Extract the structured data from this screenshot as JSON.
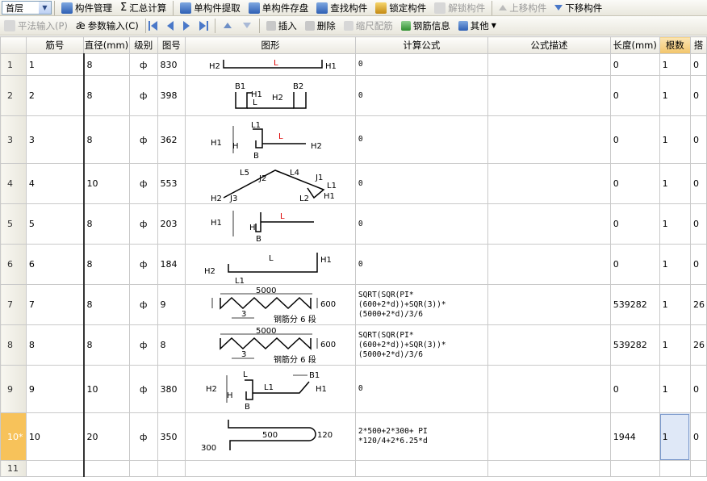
{
  "toolbar1": {
    "floor_value": "首层",
    "items": [
      "构件管理",
      "汇总计算",
      "单构件提取",
      "单构件存盘",
      "查找构件",
      "锁定构件",
      "解锁构件",
      "上移构件",
      "下移构件"
    ]
  },
  "toolbar2": {
    "items": [
      "平法输入(P)",
      "参数输入(C)",
      "插入",
      "删除",
      "缩尺配筋",
      "钢筋信息",
      "其他"
    ]
  },
  "columns": [
    "筋号",
    "直径(mm)",
    "级别",
    "图号",
    "图形",
    "计算公式",
    "公式描述",
    "长度(mm)",
    "根数",
    "搭"
  ],
  "rows": [
    {
      "idx": "1",
      "no": "1",
      "dia": "8",
      "grade": "ф",
      "fig": "830",
      "formula": "0",
      "desc": "",
      "len": "0",
      "count": "1",
      "lap": "0"
    },
    {
      "idx": "2",
      "no": "2",
      "dia": "8",
      "grade": "ф",
      "fig": "398",
      "formula": "0",
      "desc": "",
      "len": "0",
      "count": "1",
      "lap": "0"
    },
    {
      "idx": "3",
      "no": "3",
      "dia": "8",
      "grade": "ф",
      "fig": "362",
      "formula": "0",
      "desc": "",
      "len": "0",
      "count": "1",
      "lap": "0"
    },
    {
      "idx": "4",
      "no": "4",
      "dia": "10",
      "grade": "ф",
      "fig": "553",
      "formula": "0",
      "desc": "",
      "len": "0",
      "count": "1",
      "lap": "0"
    },
    {
      "idx": "5",
      "no": "5",
      "dia": "8",
      "grade": "ф",
      "fig": "203",
      "formula": "0",
      "desc": "",
      "len": "0",
      "count": "1",
      "lap": "0"
    },
    {
      "idx": "6",
      "no": "6",
      "dia": "8",
      "grade": "ф",
      "fig": "184",
      "formula": "0",
      "desc": "",
      "len": "0",
      "count": "1",
      "lap": "0"
    },
    {
      "idx": "7",
      "no": "7",
      "dia": "8",
      "grade": "ф",
      "fig": "9",
      "formula": "SQRT(SQR(PI*(600+2*d))+SQR(3))*(5000+2*d)/3/6",
      "desc": "",
      "len": "539282",
      "count": "1",
      "lap": "26"
    },
    {
      "idx": "8",
      "no": "8",
      "dia": "8",
      "grade": "ф",
      "fig": "8",
      "formula": "SQRT(SQR(PI*(600+2*d))+SQR(3))*(5000+2*d)/3/6",
      "desc": "",
      "len": "539282",
      "count": "1",
      "lap": "26"
    },
    {
      "idx": "9",
      "no": "9",
      "dia": "10",
      "grade": "ф",
      "fig": "380",
      "formula": "0",
      "desc": "",
      "len": "0",
      "count": "1",
      "lap": "0"
    },
    {
      "idx": "10*",
      "no": "10",
      "dia": "20",
      "grade": "ф",
      "fig": "350",
      "formula": "2*500+2*300+ PI *120/4+2*6.25*d",
      "desc": "",
      "len": "1944",
      "count": "1",
      "lap": "0"
    },
    {
      "idx": "11",
      "no": "",
      "dia": "",
      "grade": "",
      "fig": "",
      "formula": "",
      "desc": "",
      "len": "",
      "count": "",
      "lap": ""
    }
  ],
  "shapes": {
    "s1": {
      "left": "H2",
      "mid": "L",
      "right": "H1"
    },
    "s2": {
      "b1": "B1",
      "b2": "B2",
      "h1": "H1",
      "h2": "H2",
      "l": "L"
    },
    "s3": {
      "l1": "L1",
      "l": "L",
      "h1": "H1",
      "h": "H",
      "b": "B",
      "h2": "H2"
    },
    "s4": {
      "l5": "L5",
      "l4": "L4",
      "j1": "J1",
      "j2": "J2",
      "l1": "L1",
      "h2": "H2",
      "j3": "J3",
      "l2": "L2",
      "h1": "H1"
    },
    "s5": {
      "h1": "H1",
      "h": "H",
      "b": "B",
      "l": "L"
    },
    "s6": {
      "h2": "H2",
      "l": "L",
      "h1": "H1",
      "l1": "L1"
    },
    "s7": {
      "top": "5000",
      "right": "600",
      "pitch": "3",
      "note": "钢筋分 6 段"
    },
    "s8": {
      "top": "5000",
      "right": "600",
      "pitch": "3",
      "note": "钢筋分 6 段"
    },
    "s9": {
      "l": "L",
      "b1": "B1",
      "h2": "H2",
      "h": "H",
      "l1": "L1",
      "h1": "H1",
      "b": "B"
    },
    "s10": {
      "l": "500",
      "r": "120",
      "h": "300"
    }
  }
}
